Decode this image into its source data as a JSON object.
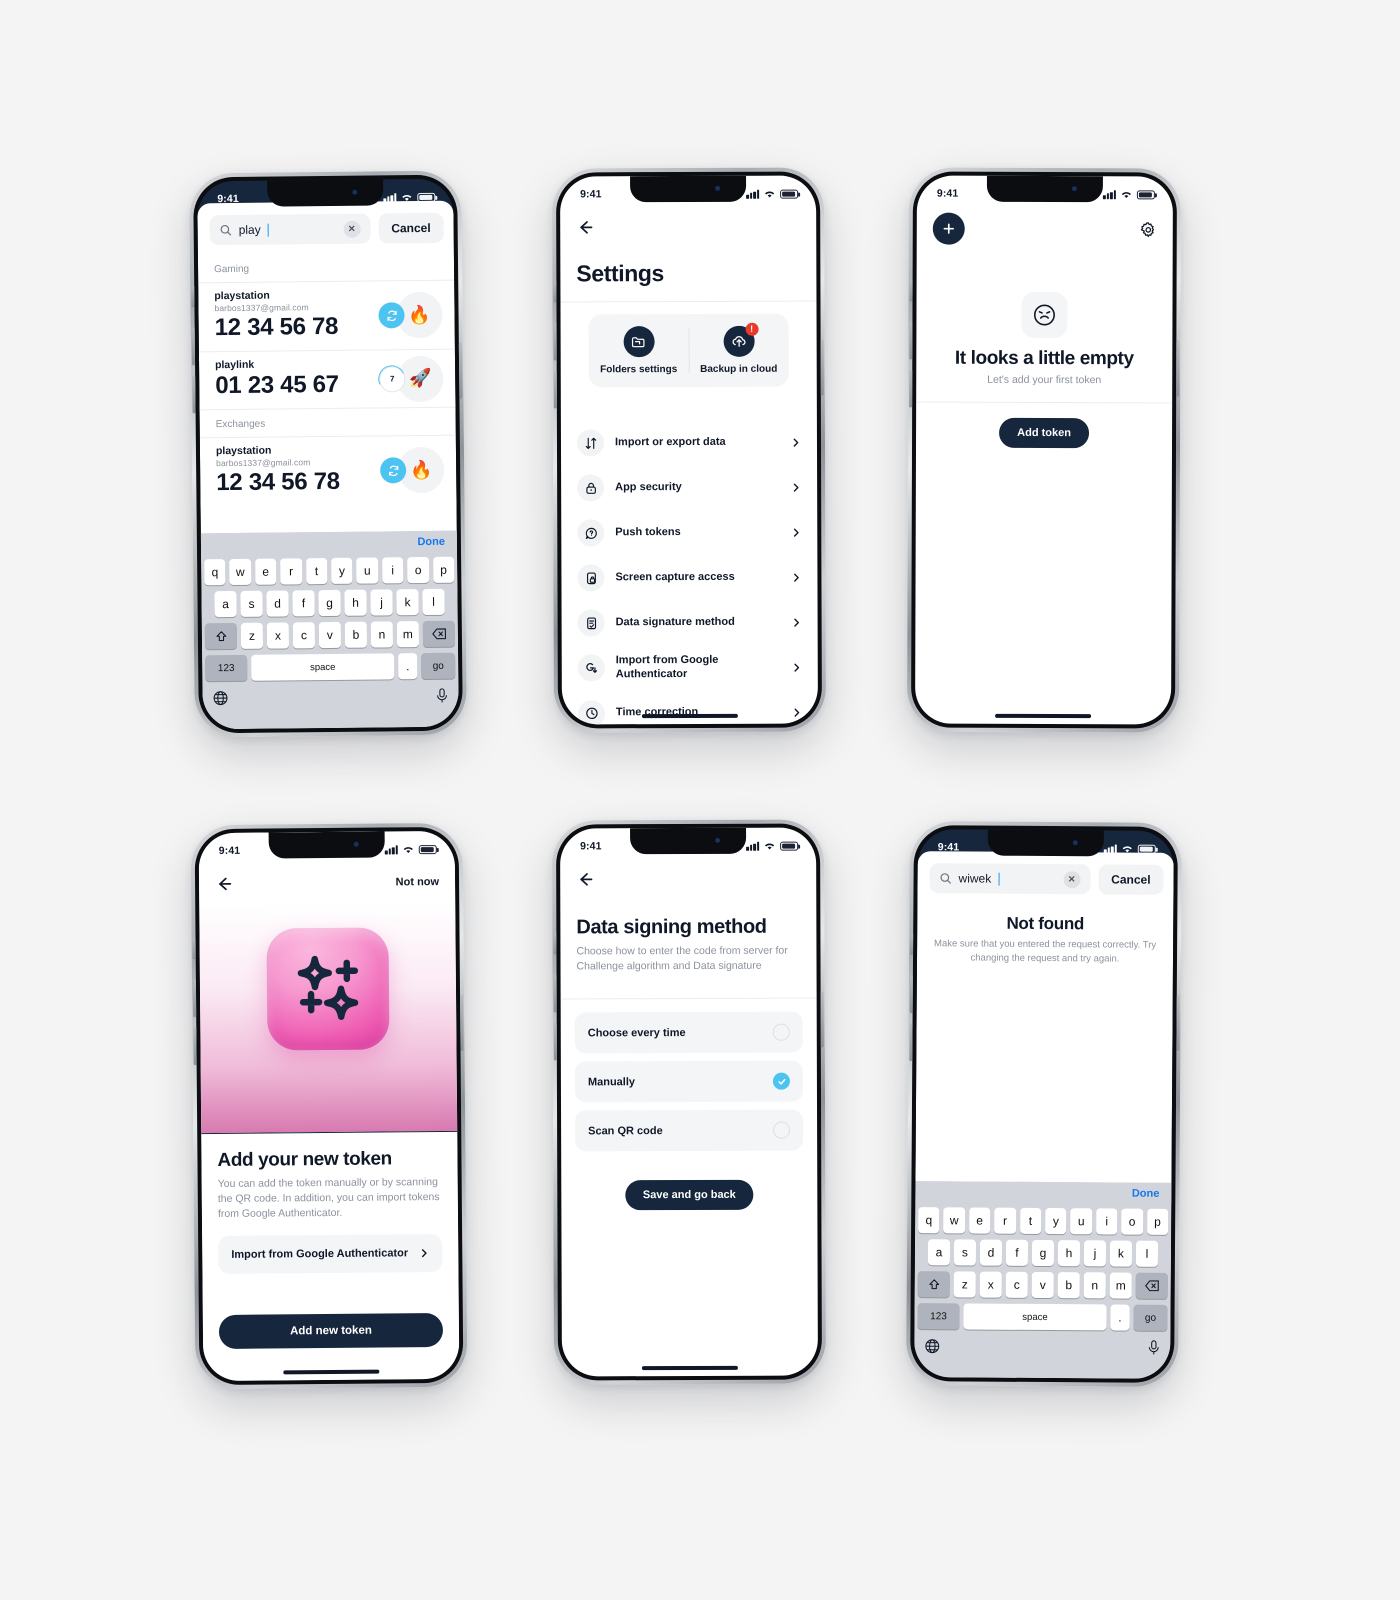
{
  "meta": {
    "background": "#f4f4f4",
    "brand_navy": "#16263d",
    "accent_cyan": "#4cc3f0",
    "alert_red": "#e8392b"
  },
  "status_bar": {
    "time": "9:41"
  },
  "keyboard": {
    "row1": [
      "q",
      "w",
      "e",
      "r",
      "t",
      "y",
      "u",
      "i",
      "o",
      "p"
    ],
    "row2": [
      "a",
      "s",
      "d",
      "f",
      "g",
      "h",
      "j",
      "k",
      "l"
    ],
    "row3": [
      "z",
      "x",
      "c",
      "v",
      "b",
      "n",
      "m"
    ],
    "shift_icon": "shift-icon",
    "backspace_icon": "backspace-icon",
    "numbers_key": "123",
    "space_key": "space",
    "period_key": ".",
    "go_key": "go",
    "globe_icon": "globe-icon",
    "mic_icon": "microphone-icon",
    "done_label": "Done"
  },
  "screen1_search": {
    "search_value": "play",
    "clear_icon": "clear-icon",
    "search_icon": "search-icon",
    "cancel_label": "Cancel",
    "sections": [
      {
        "title": "Gaming",
        "tokens": [
          {
            "name": "playstation",
            "account": "barbos1337@gmail.com",
            "code": "12 34 56 78",
            "emoji": "🔥",
            "badge_type": "sync",
            "badge_value": ""
          },
          {
            "name": "playlink",
            "account": "",
            "code": "01 23 45 67",
            "emoji": "🚀",
            "badge_type": "count",
            "badge_value": "7"
          }
        ]
      },
      {
        "title": "Exchanges",
        "tokens": [
          {
            "name": "playstation",
            "account": "barbos1337@gmail.com",
            "code": "12 34 56 78",
            "emoji": "🔥",
            "badge_type": "sync",
            "badge_value": ""
          }
        ]
      }
    ]
  },
  "screen2_settings": {
    "back_icon": "back-arrow-icon",
    "title": "Settings",
    "tiles": [
      {
        "label": "Folders settings",
        "icon": "folder-icon",
        "badge": ""
      },
      {
        "label": "Backup in cloud",
        "icon": "cloud-upload-icon",
        "badge": "!"
      }
    ],
    "items": [
      {
        "label": "Import or export data",
        "icon": "import-export-icon"
      },
      {
        "label": "App security",
        "icon": "lock-icon"
      },
      {
        "label": "Push tokens",
        "icon": "question-bubble-icon"
      },
      {
        "label": "Screen capture access",
        "icon": "phone-lock-icon"
      },
      {
        "label": "Data signature method",
        "icon": "document-check-icon"
      },
      {
        "label": "Import from Google Authenticator",
        "icon": "google-download-icon"
      },
      {
        "label": "Time correction",
        "icon": "clock-icon"
      }
    ]
  },
  "screen3_empty": {
    "add_icon": "plus-icon",
    "settings_icon": "gear-icon",
    "face_icon": "sad-face-icon",
    "title": "It looks a little empty",
    "subtitle": "Let's add your first token",
    "button_label": "Add token"
  },
  "screen4_add_token": {
    "back_icon": "back-arrow-icon",
    "not_now_label": "Not now",
    "hero_icon": "sparkles-icon",
    "title": "Add your new token",
    "description": "You can add the token manually or by scanning the QR code. In addition, you can import tokens from Google Authenticator.",
    "import_label": "Import from Google Authenticator",
    "chevron_icon": "chevron-right-icon",
    "primary_button": "Add new token"
  },
  "screen5_signing": {
    "back_icon": "back-arrow-icon",
    "title": "Data signing method",
    "description": "Choose how to enter the code from server for Challenge algorithm and Data signature",
    "options": [
      {
        "label": "Choose every time",
        "selected": false
      },
      {
        "label": "Manually",
        "selected": true
      },
      {
        "label": "Scan QR code",
        "selected": false
      }
    ],
    "save_button": "Save and go back"
  },
  "screen6_not_found": {
    "search_value": "wiwek",
    "search_icon": "search-icon",
    "clear_icon": "clear-icon",
    "cancel_label": "Cancel",
    "title": "Not found",
    "subtitle": "Make sure that you entered the request correctly. Try changing the request and try again."
  }
}
